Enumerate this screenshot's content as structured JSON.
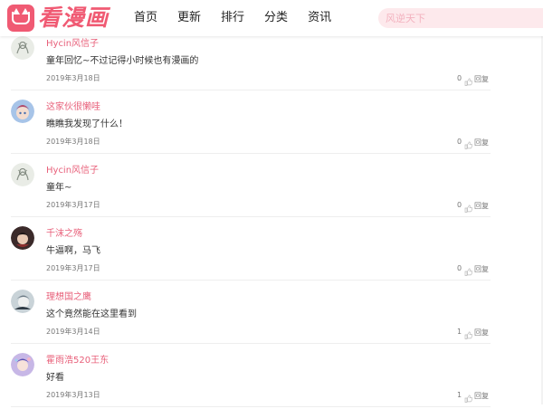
{
  "brand": {
    "logo_text": "看漫画",
    "accent": "#f05a73"
  },
  "nav": [
    "首页",
    "更新",
    "排行",
    "分类",
    "资讯"
  ],
  "search": {
    "placeholder": "风逆天下"
  },
  "comments": [
    {
      "user": "Hycin风信子",
      "text": "童年回忆~不过记得小时候也有漫画的",
      "date": "2019年3月18日",
      "likes": "0",
      "reply": "回复",
      "avatar": "sketch"
    },
    {
      "user": "这家伙很懒哇",
      "text": "瞧瞧我发现了什么！",
      "date": "2019年3月18日",
      "likes": "0",
      "reply": "回复",
      "avatar": "anime-blue"
    },
    {
      "user": "Hycin风信子",
      "text": "童年~",
      "date": "2019年3月17日",
      "likes": "0",
      "reply": "回复",
      "avatar": "sketch"
    },
    {
      "user": "千沫之殇",
      "text": "牛逼啊，马飞",
      "date": "2019年3月17日",
      "likes": "0",
      "reply": "回复",
      "avatar": "anime-dark"
    },
    {
      "user": "理想国之鹰",
      "text": "这个竟然能在这里看到",
      "date": "2019年3月14日",
      "likes": "1",
      "reply": "回复",
      "avatar": "anime-gray"
    },
    {
      "user": "霍雨浩520王东",
      "text": "好看",
      "date": "2019年3月13日",
      "likes": "1",
      "reply": "回复",
      "avatar": "anime-purple"
    }
  ]
}
